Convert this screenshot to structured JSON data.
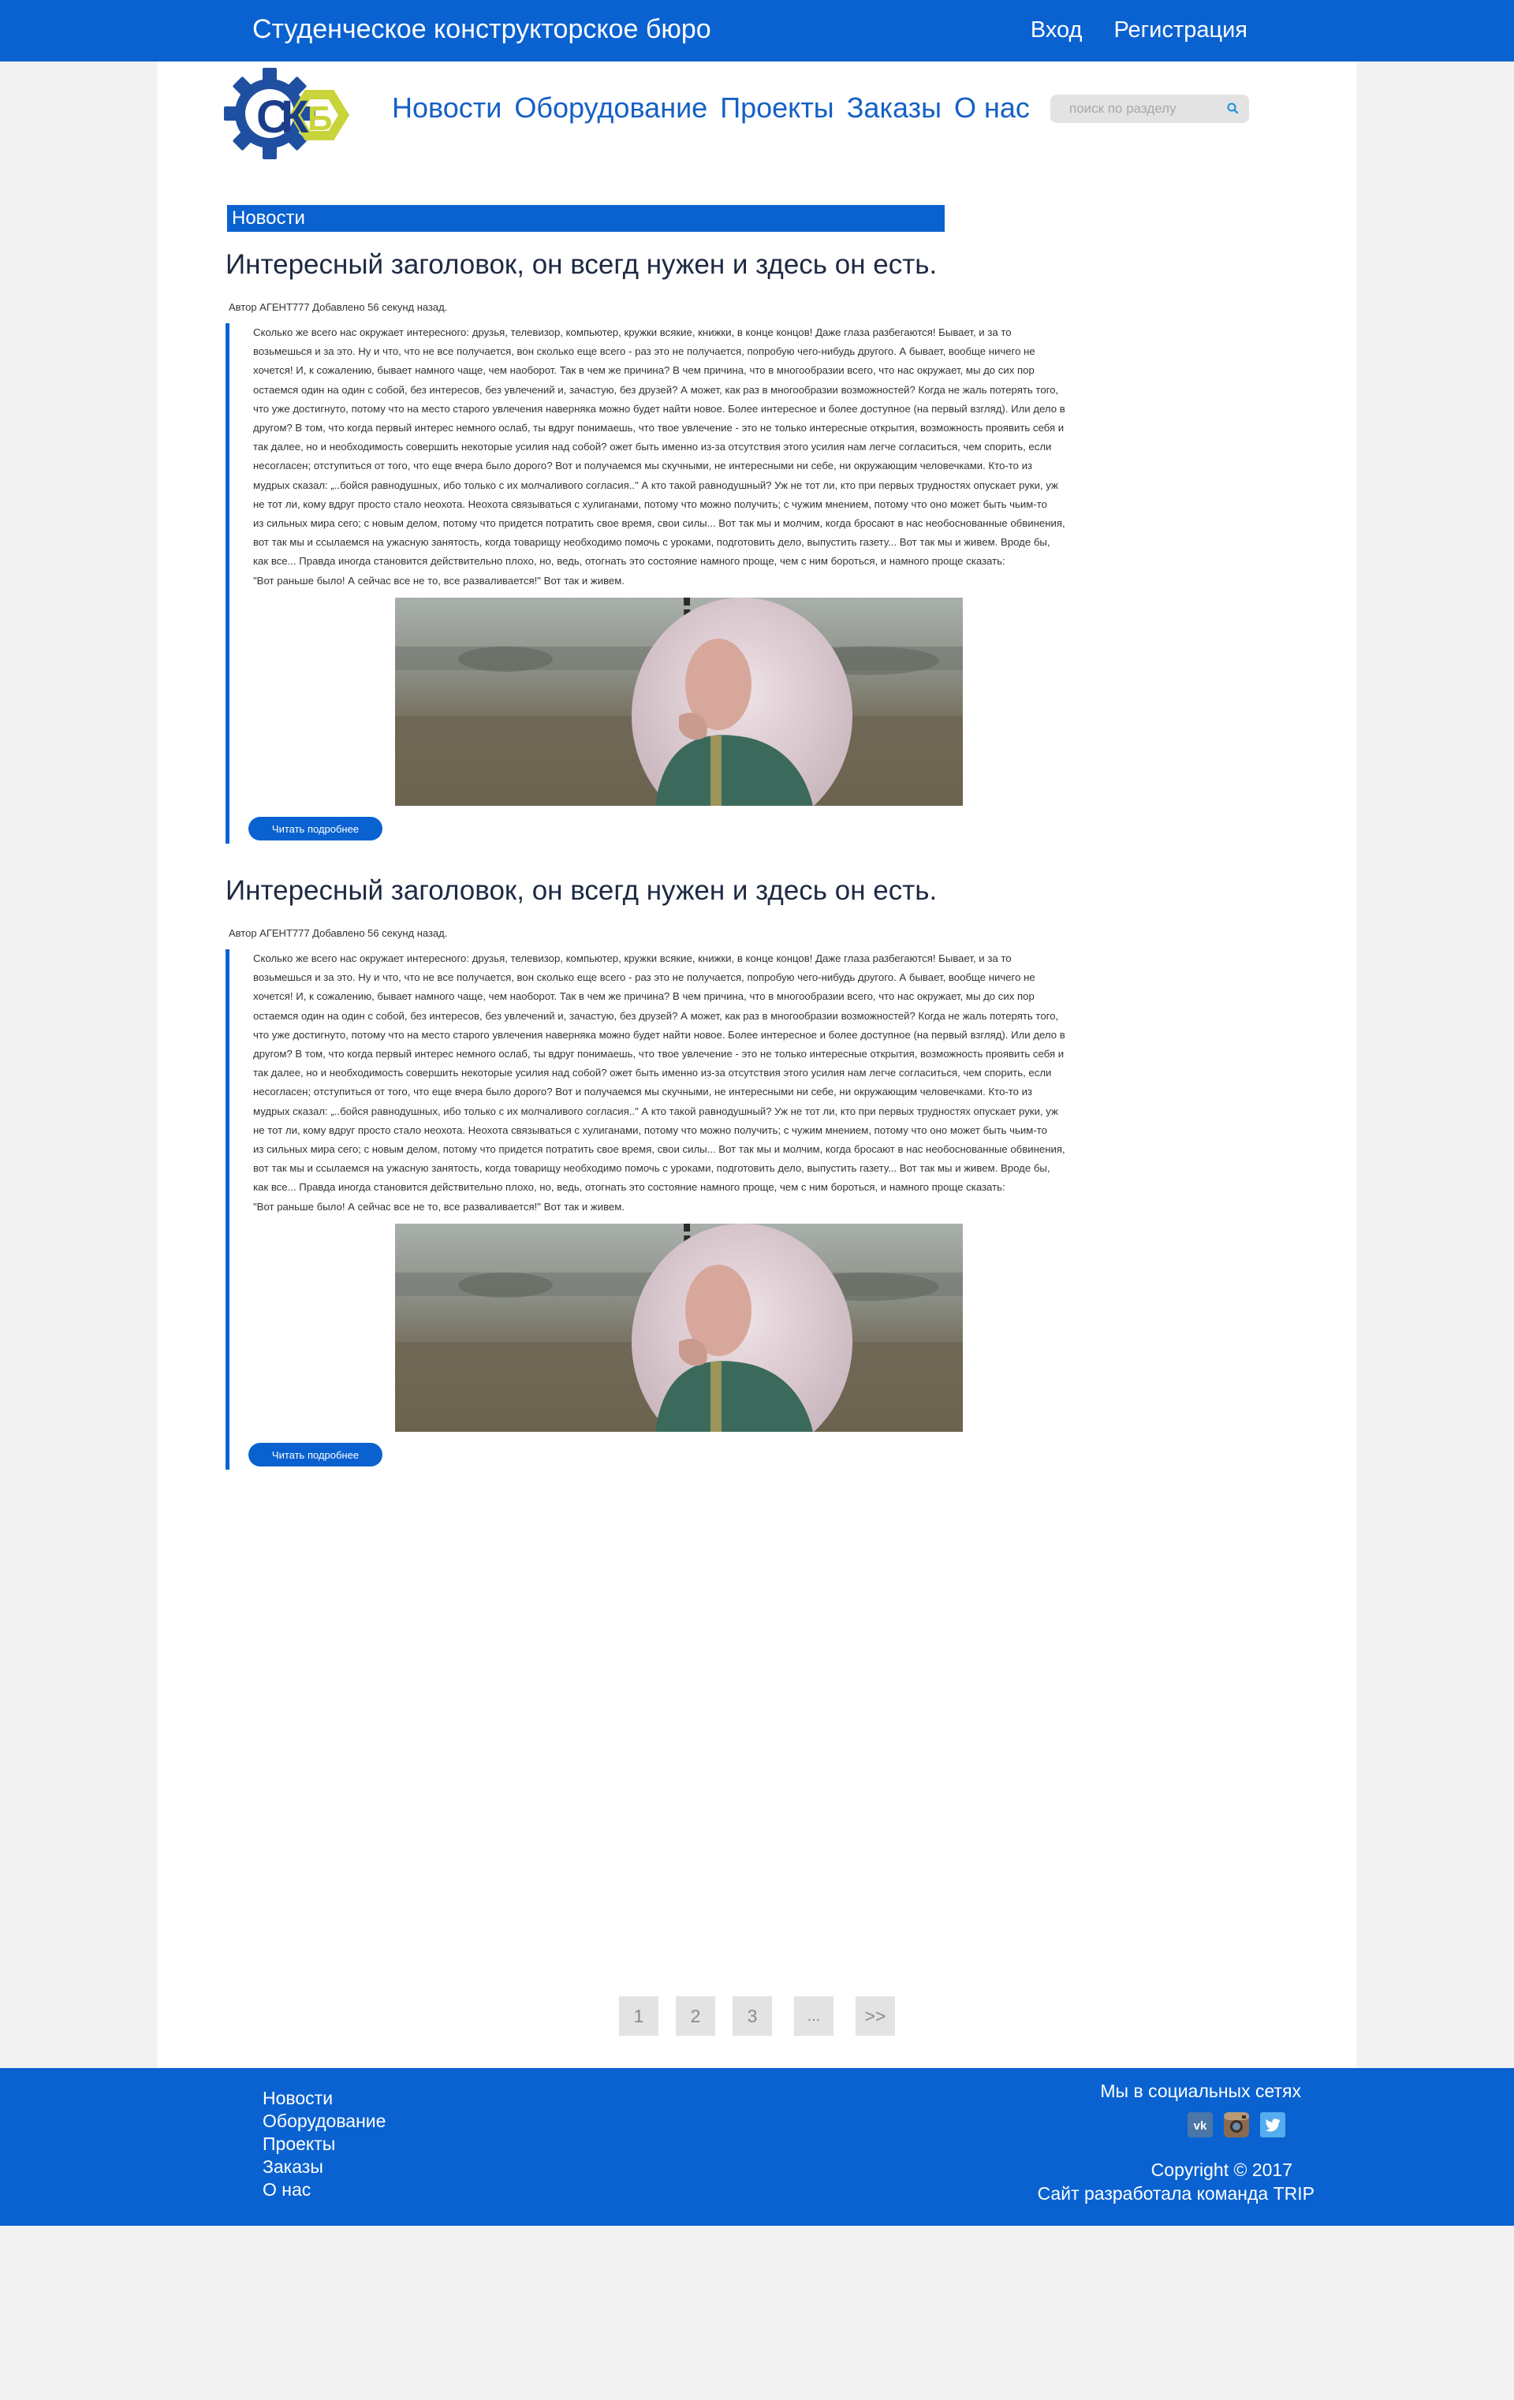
{
  "topbar": {
    "site_title": "Студенческое конструкторское бюро",
    "login": "Вход",
    "register": "Регистрация"
  },
  "nav": {
    "items": [
      {
        "label": "Новости"
      },
      {
        "label": "Оборудование"
      },
      {
        "label": "Проекты"
      },
      {
        "label": "Заказы"
      },
      {
        "label": "О нас"
      }
    ]
  },
  "search": {
    "placeholder": "поиск по разделу",
    "icon": "search-icon"
  },
  "section": {
    "title": "Новости"
  },
  "articles": [
    {
      "title": "Интересный заголовок, он всегд нужен и здесь он есть.",
      "meta": "Автор АГЕНТ777 Добавлено 56 секунд назад.",
      "text": "  Сколько же всего нас окружает интересного: друзья, телевизор, компьютер, кружки всякие, книжки, в конце концов! Даже глаза разбегаются! Бывает, и за то\nвозьмешься и за это. Ну и что, что не все получается, вон сколько еще всего - раз это не получается, попробую чего-нибудь другого. А бывает, вообще ничего не\nхочется! И, к сожалению, бывает намного чаще, чем наоборот. Так в чем же причина? В чем причина, что в многообразии всего, что нас окружает, мы до сих пор\n остаемся один на один с собой, без интересов, без увлечений и, зачастую, без друзей?   А может, как раз в многообразии возможностей? Когда не жаль потерять того,\n что уже достигнуто, потому что на место старого увлечения наверняка можно будет найти новое. Более интересное и более доступное (на первый взгляд).  Или дело в\nдругом? В том, что когда первый интерес немного ослаб, ты вдруг понимаешь, что твое увлечение - это не только интересные открытия, возможность проявить себя и\n так далее, но и необходимость совершить некоторые усилия над собой? ожет быть именно из-за отсутствия этого усилия нам легче согласиться, чем спорить, если\n несогласен; отступиться от того, что еще вчера было дорого? Вот и получаемся мы скучными, не интересными ни себе, ни окружающим человечками. Кто-то из\nмудрых сказал: „..бойся равнодушных, ибо только с их молчаливого согласия..\" А кто такой равнодушный? Уж не тот ли, кто при первых трудностях опускает руки, уж\n не тот ли, кому вдруг просто стало неохота. Неохота связываться с хулиганами, потому что можно получить; с чужим мнением, потому что оно может быть чьим-то\nиз сильных мира сего; с новым делом, потому что придется потратить свое время, свои силы...   Вот так мы и молчим, когда бросают в нас необоснованные обвинения,\n вот так мы и ссылаемся на ужасную занятость, когда товарищу необходимо помочь с уроками, подготовить дело, выпустить газету... Вот так мы и живем. Вроде бы,\nкак все... Правда иногда становится действительно плохо, но, ведь, отогнать это состояние намного проще, чем с ним бороться, и намного проще сказать:\n\"Вот раньше было! А сейчас все не то, все разваливается!\" Вот так и живем.",
      "more_label": "Читать подробнее"
    },
    {
      "title": "Интересный заголовок, он всегд нужен и здесь он есть.",
      "meta": "Автор АГЕНТ777 Добавлено 56 секунд назад.",
      "text": "  Сколько же всего нас окружает интересного: друзья, телевизор, компьютер, кружки всякие, книжки, в конце концов! Даже глаза разбегаются! Бывает, и за то\nвозьмешься и за это. Ну и что, что не все получается, вон сколько еще всего - раз это не получается, попробую чего-нибудь другого. А бывает, вообще ничего не\nхочется! И, к сожалению, бывает намного чаще, чем наоборот. Так в чем же причина? В чем причина, что в многообразии всего, что нас окружает, мы до сих пор\n остаемся один на один с собой, без интересов, без увлечений и, зачастую, без друзей?   А может, как раз в многообразии возможностей? Когда не жаль потерять того,\n что уже достигнуто, потому что на место старого увлечения наверняка можно будет найти новое. Более интересное и более доступное (на первый взгляд).  Или дело в\nдругом? В том, что когда первый интерес немного ослаб, ты вдруг понимаешь, что твое увлечение - это не только интересные открытия, возможность проявить себя и\n так далее, но и необходимость совершить некоторые усилия над собой? ожет быть именно из-за отсутствия этого усилия нам легче согласиться, чем спорить, если\n несогласен; отступиться от того, что еще вчера было дорого? Вот и получаемся мы скучными, не интересными ни себе, ни окружающим человечками. Кто-то из\nмудрых сказал: „..бойся равнодушных, ибо только с их молчаливого согласия..\" А кто такой равнодушный? Уж не тот ли, кто при первых трудностях опускает руки, уж\n не тот ли, кому вдруг просто стало неохота. Неохота связываться с хулиганами, потому что можно получить; с чужим мнением, потому что оно может быть чьим-то\nиз сильных мира сего; с новым делом, потому что придется потратить свое время, свои силы...   Вот так мы и молчим, когда бросают в нас необоснованные обвинения,\n вот так мы и ссылаемся на ужасную занятость, когда товарищу необходимо помочь с уроками, подготовить дело, выпустить газету... Вот так мы и живем. Вроде бы,\nкак все... Правда иногда становится действительно плохо, но, ведь, отогнать это состояние намного проще, чем с ним бороться, и намного проще сказать:\n\"Вот раньше было! А сейчас все не то, все разваливается!\" Вот так и живем.",
      "more_label": "Читать подробнее"
    }
  ],
  "pagination": {
    "pages": [
      "1",
      "2",
      "3"
    ],
    "ellipsis": "...",
    "next": ">>"
  },
  "footer": {
    "nav": [
      "Новости",
      "Оборудование",
      "Проекты",
      "Заказы",
      "О нас"
    ],
    "social_title": "Мы в социальных сетях",
    "social_icons": [
      "vk-icon",
      "instagram-icon",
      "twitter-icon"
    ],
    "copyright": "Copyright © 2017",
    "credits": "Сайт разработала команда TRIP"
  },
  "colors": {
    "brand_blue": "#0a62d1",
    "nav_text": "#1560c6",
    "page_bg": "#f2f2f2",
    "button_grey": "#e3e3e3",
    "logo_yellow": "#c8d43a"
  }
}
